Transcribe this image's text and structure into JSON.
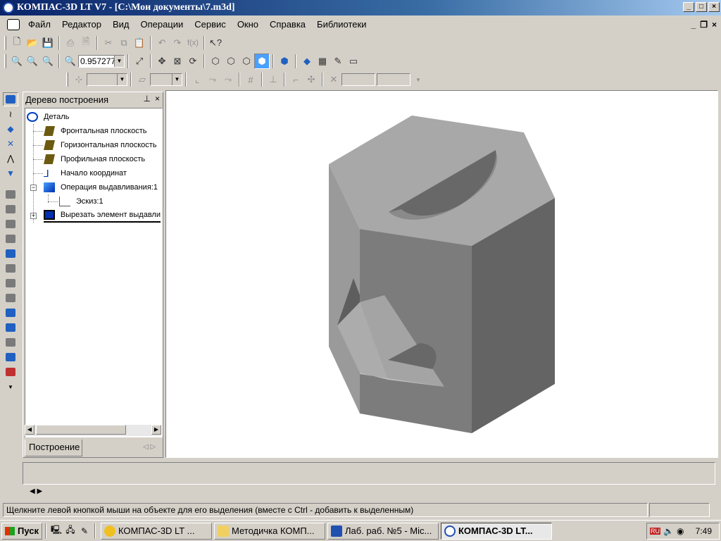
{
  "window": {
    "title": "КОМПАС-3D LT V7 - [C:\\Мои документы\\7.m3d]"
  },
  "menu": {
    "items": [
      "Файл",
      "Редактор",
      "Вид",
      "Операции",
      "Сервис",
      "Окно",
      "Справка",
      "Библиотеки"
    ]
  },
  "toolbar": {
    "zoom_value": "0.957277"
  },
  "tree": {
    "title": "Дерево построения",
    "items": [
      {
        "label": "Деталь",
        "icon": "detail-icon"
      },
      {
        "label": "Фронтальная плоскость",
        "icon": "plane-icon"
      },
      {
        "label": "Горизонтальная плоскость",
        "icon": "plane-icon"
      },
      {
        "label": "Профильная плоскость",
        "icon": "plane-icon"
      },
      {
        "label": "Начало координат",
        "icon": "origin-icon"
      },
      {
        "label": "Операция выдавливания:1",
        "icon": "extrude-icon"
      },
      {
        "label": "Эскиз:1",
        "icon": "sketch-icon"
      },
      {
        "label": "Вырезать элемент выдавли",
        "icon": "cut-extrude-icon"
      }
    ],
    "tab": "Построение"
  },
  "status": {
    "text": "Щелкните левой кнопкой мыши на объекте для его выделения (вместе с Ctrl - добавить к выделенным)"
  },
  "taskbar": {
    "start": "Пуск",
    "tasks": [
      "КОМПАС-3D LT ...",
      "Методичка КОМП...",
      "Лаб. раб. №5 - Mic...",
      "КОМПАС-3D LT..."
    ],
    "lang": "RU",
    "clock": "7:49"
  },
  "colors": {
    "titlebar": "#0a246a",
    "desktop": "#d4d0c8",
    "model_top": "#a0a0a0",
    "model_front": "#7a7a7a",
    "model_side": "#646464"
  }
}
